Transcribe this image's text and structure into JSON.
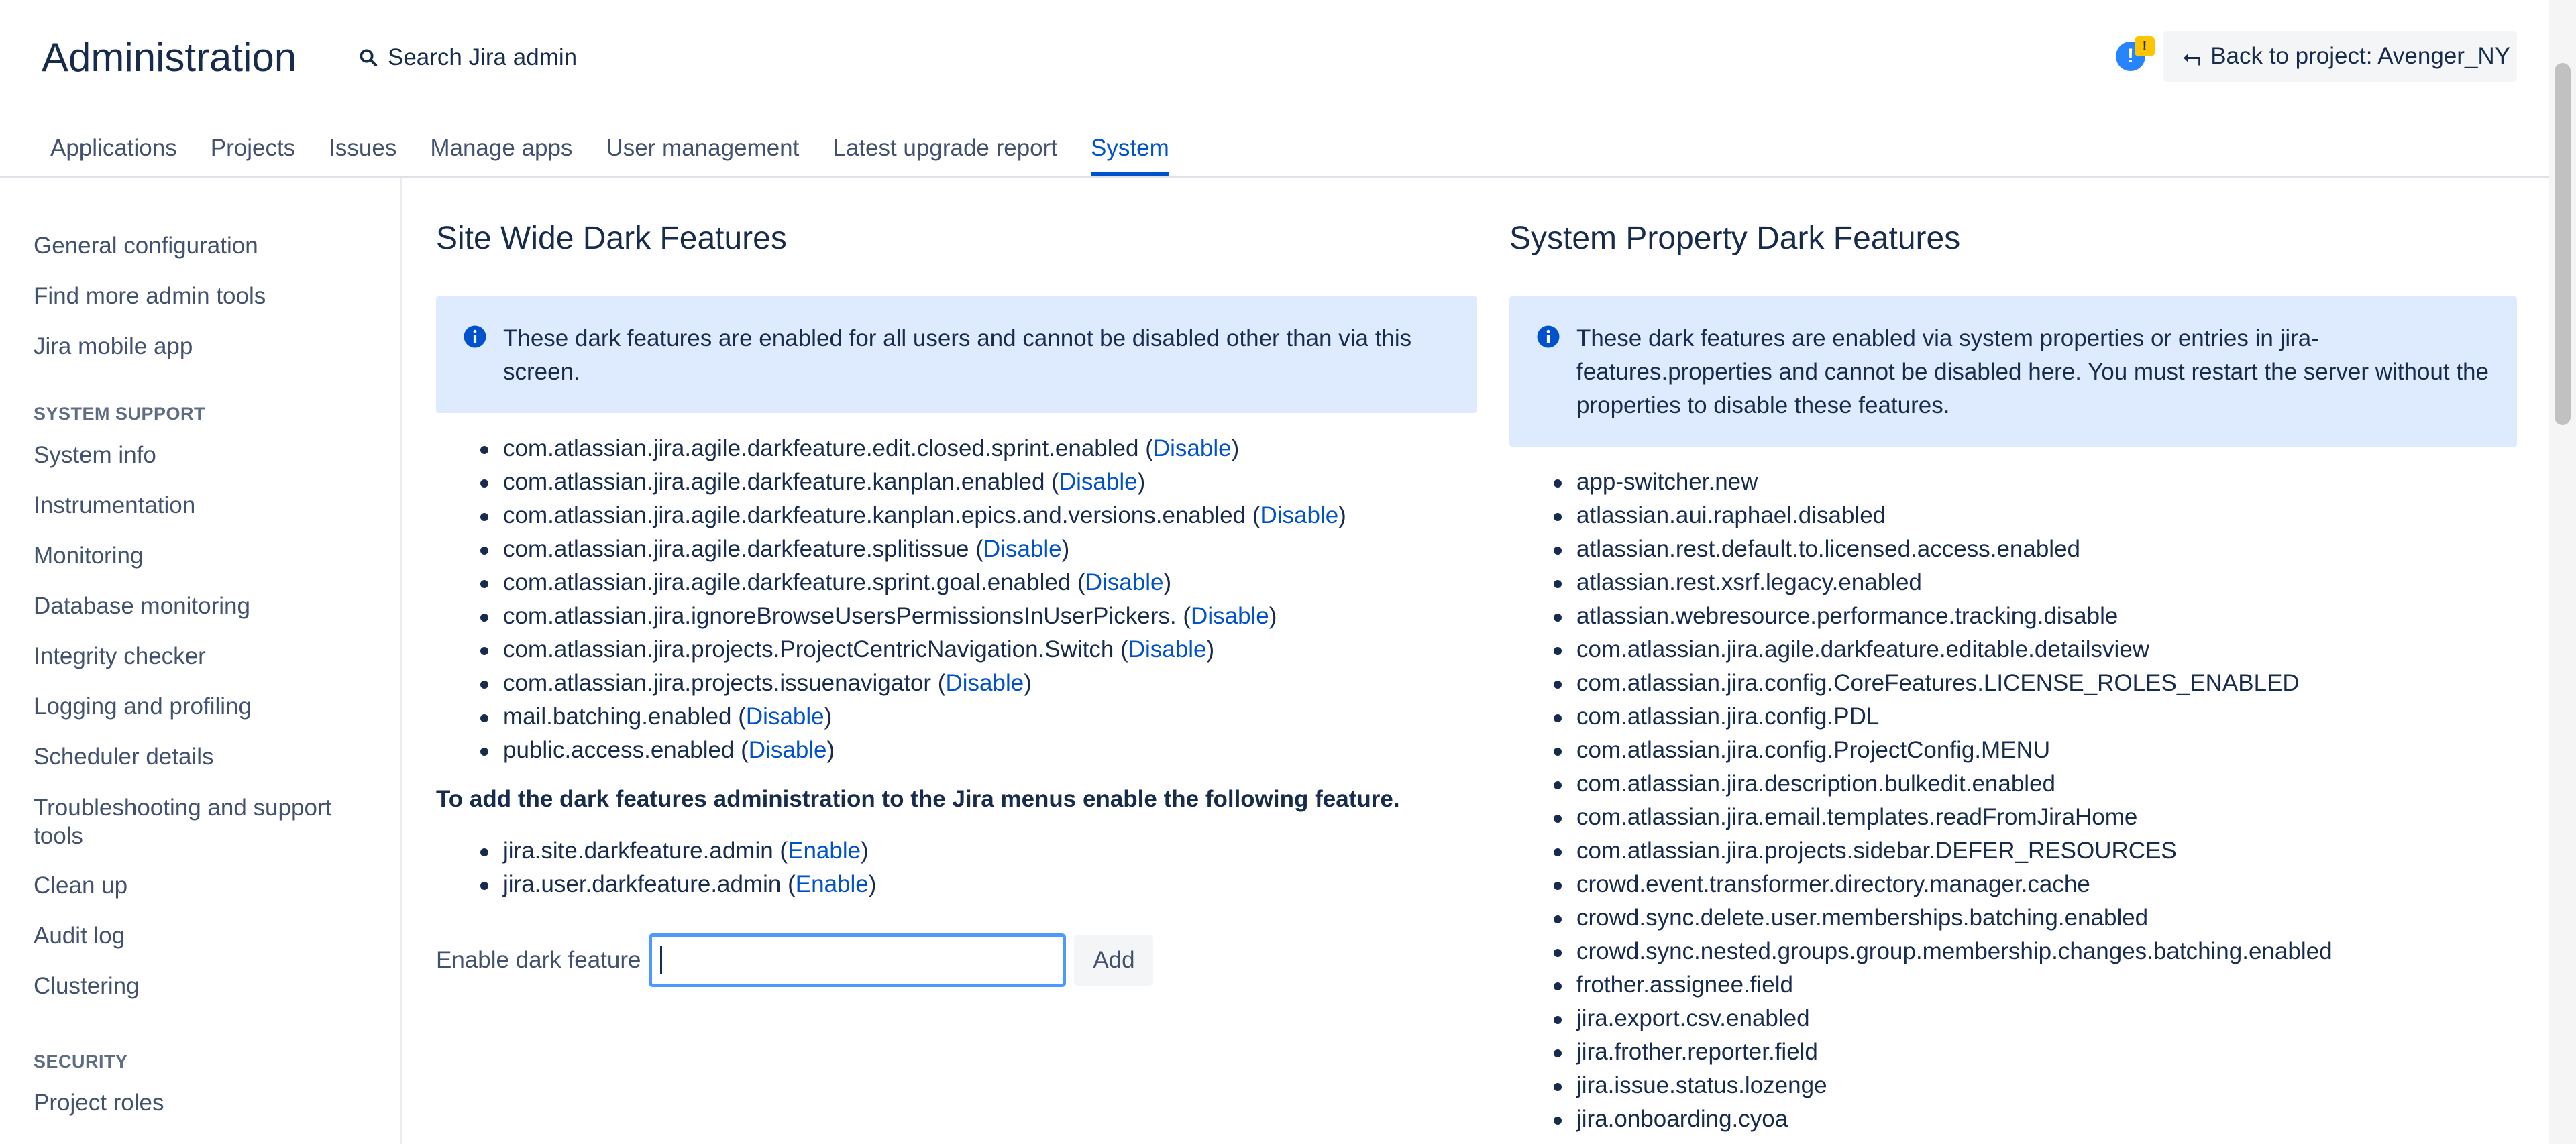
{
  "header": {
    "title": "Administration",
    "search_label": "Search Jira admin",
    "notification_badge": "!",
    "back_button": "Back to project: Avenger_NY"
  },
  "nav_tabs": [
    {
      "label": "Applications",
      "active": false
    },
    {
      "label": "Projects",
      "active": false
    },
    {
      "label": "Issues",
      "active": false
    },
    {
      "label": "Manage apps",
      "active": false
    },
    {
      "label": "User management",
      "active": false
    },
    {
      "label": "Latest upgrade report",
      "active": false
    },
    {
      "label": "System",
      "active": true
    }
  ],
  "sidebar": {
    "top_items": [
      "General configuration",
      "Find more admin tools",
      "Jira mobile app"
    ],
    "system_support_heading": "SYSTEM SUPPORT",
    "system_support_items": [
      "System info",
      "Instrumentation",
      "Monitoring",
      "Database monitoring",
      "Integrity checker",
      "Logging and profiling",
      "Scheduler details",
      "Troubleshooting and support tools",
      "Clean up",
      "Audit log",
      "Clustering"
    ],
    "security_heading": "SECURITY",
    "security_items": [
      "Project roles"
    ]
  },
  "site_wide": {
    "title": "Site Wide Dark Features",
    "info": "These dark features are enabled for all users and cannot be disabled other than via this screen.",
    "features": [
      "com.atlassian.jira.agile.darkfeature.edit.closed.sprint.enabled",
      "com.atlassian.jira.agile.darkfeature.kanplan.enabled",
      "com.atlassian.jira.agile.darkfeature.kanplan.epics.and.versions.enabled",
      "com.atlassian.jira.agile.darkfeature.splitissue",
      "com.atlassian.jira.agile.darkfeature.sprint.goal.enabled",
      "com.atlassian.jira.ignoreBrowseUsersPermissionsInUserPickers.",
      "com.atlassian.jira.projects.ProjectCentricNavigation.Switch",
      "com.atlassian.jira.projects.issuenavigator",
      "mail.batching.enabled",
      "public.access.enabled"
    ],
    "disable_label": "Disable",
    "admin_note": "To add the dark features administration to the Jira menus enable the following feature.",
    "admin_features": [
      "jira.site.darkfeature.admin",
      "jira.user.darkfeature.admin"
    ],
    "enable_label": "Enable",
    "form_label": "Enable dark feature",
    "form_value": "",
    "add_button": "Add"
  },
  "system_property": {
    "title": "System Property Dark Features",
    "info": "These dark features are enabled via system properties or entries in jira-features.properties and cannot be disabled here. You must restart the server without the properties to disable these features.",
    "features": [
      "app-switcher.new",
      "atlassian.aui.raphael.disabled",
      "atlassian.rest.default.to.licensed.access.enabled",
      "atlassian.rest.xsrf.legacy.enabled",
      "atlassian.webresource.performance.tracking.disable",
      "com.atlassian.jira.agile.darkfeature.editable.detailsview",
      "com.atlassian.jira.config.CoreFeatures.LICENSE_ROLES_ENABLED",
      "com.atlassian.jira.config.PDL",
      "com.atlassian.jira.config.ProjectConfig.MENU",
      "com.atlassian.jira.description.bulkedit.enabled",
      "com.atlassian.jira.email.templates.readFromJiraHome",
      "com.atlassian.jira.projects.sidebar.DEFER_RESOURCES",
      "crowd.event.transformer.directory.manager.cache",
      "crowd.sync.delete.user.memberships.batching.enabled",
      "crowd.sync.nested.groups.group.membership.changes.batching.enabled",
      "frother.assignee.field",
      "jira.export.csv.enabled",
      "jira.frother.reporter.field",
      "jira.issue.status.lozenge",
      "jira.onboarding.cyoa"
    ]
  },
  "colors": {
    "link": "#0052cc",
    "text": "#172b4d",
    "info_bg": "#deebff",
    "info_icon": "#0052cc",
    "active_tab": "#0052cc"
  }
}
